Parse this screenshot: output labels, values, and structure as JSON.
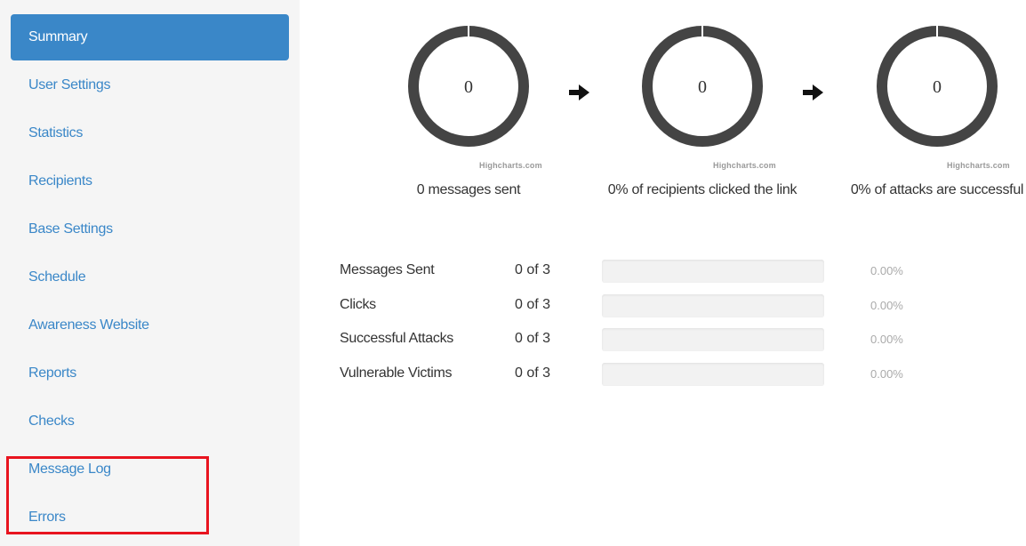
{
  "sidebar": {
    "items": [
      {
        "label": "Summary",
        "active": true
      },
      {
        "label": "User Settings"
      },
      {
        "label": "Statistics"
      },
      {
        "label": "Recipients"
      },
      {
        "label": "Base Settings"
      },
      {
        "label": "Schedule"
      },
      {
        "label": "Awareness Website"
      },
      {
        "label": "Reports"
      },
      {
        "label": "Checks"
      },
      {
        "label": "Message Log"
      },
      {
        "label": "Errors"
      }
    ]
  },
  "gauges": [
    {
      "value": "0",
      "credit": "Highcharts.com",
      "caption": "0 messages sent"
    },
    {
      "value": "0",
      "credit": "Highcharts.com",
      "caption": "0% of recipients clicked the link"
    },
    {
      "value": "0",
      "credit": "Highcharts.com",
      "caption": "0% of attacks are successful"
    }
  ],
  "stats": [
    {
      "label": "Messages Sent",
      "count": "0 of 3",
      "percent": "0.00%",
      "fraction": 0
    },
    {
      "label": "Clicks",
      "count": "0 of 3",
      "percent": "0.00%",
      "fraction": 0
    },
    {
      "label": "Successful Attacks",
      "count": "0 of 3",
      "percent": "0.00%",
      "fraction": 0
    },
    {
      "label": "Vulnerable Victims",
      "count": "0 of 3",
      "percent": "0.00%",
      "fraction": 0
    }
  ],
  "colors": {
    "accent": "#3a87c8",
    "gauge_ring": "#444444",
    "highlight": "#e8141f"
  }
}
